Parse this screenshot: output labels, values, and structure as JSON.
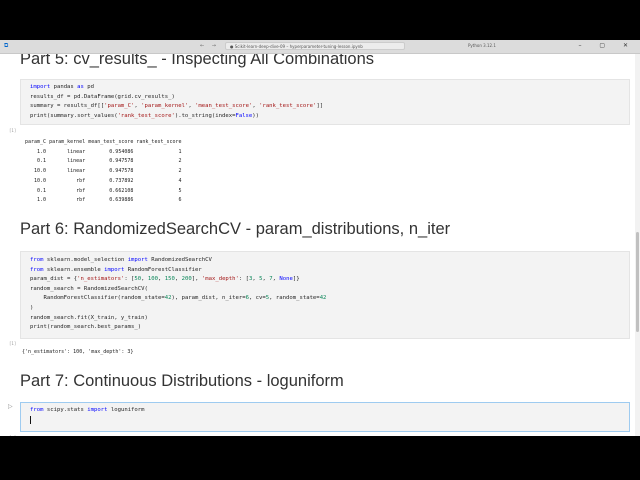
{
  "window": {
    "nav_arrows": "← →",
    "search_text": "● Scikit-learn-deep-dive-09 – hyperparameter-tuning-lesson.ipynb",
    "kernel": "Python 3.12.1",
    "controls": "– ▢ ✕"
  },
  "sections": [
    {
      "heading": "Part 5: cv_results_ - Inspecting All Combinations",
      "exec_label": "[1]",
      "output_table": {
        "columns": [
          "param_C",
          "param_kernel",
          "mean_test_score",
          "rank_test_score"
        ],
        "rows": [
          [
            "1.0",
            "linear",
            "0.954086",
            "1"
          ],
          [
            "0.1",
            "linear",
            "0.947578",
            "2"
          ],
          [
            "10.0",
            "linear",
            "0.947578",
            "2"
          ],
          [
            "10.0",
            "rbf",
            "0.737892",
            "4"
          ],
          [
            "0.1",
            "rbf",
            "0.662108",
            "5"
          ],
          [
            "1.0",
            "rbf",
            "0.639886",
            "6"
          ]
        ]
      }
    },
    {
      "heading": "Part 6: RandomizedSearchCV - param_distributions, n_iter",
      "exec_label": "[1]",
      "output_text": "{'n_estimators': 100, 'max_depth': 3}"
    },
    {
      "heading": "Part 7: Continuous Distributions - loguniform",
      "exec_label": "[ ]"
    }
  ]
}
